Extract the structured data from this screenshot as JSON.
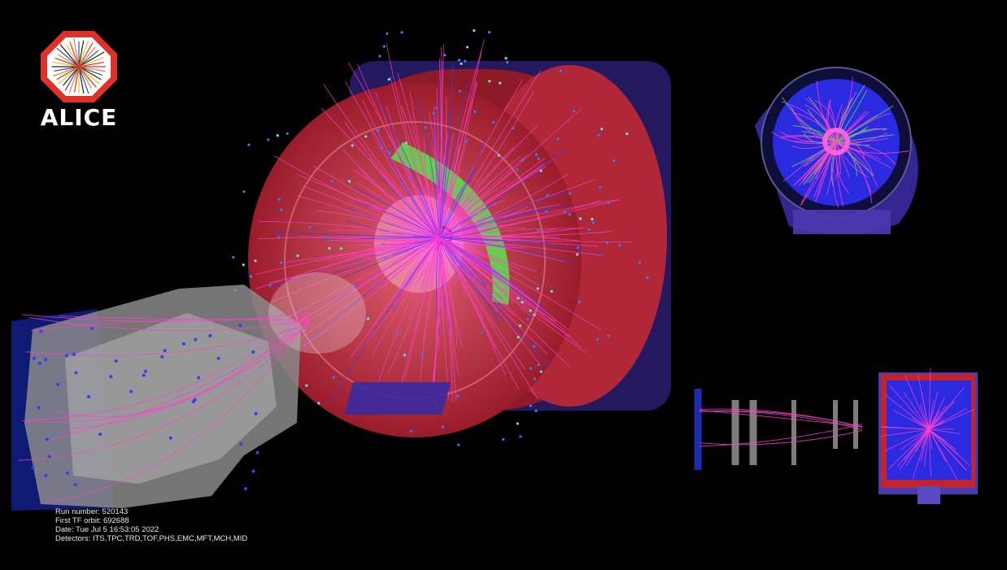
{
  "logo": {
    "name": "ALICE",
    "text": "ALICE"
  },
  "event_info": {
    "run_number": "Run number: 520143",
    "first_tf_orbit": "First TF orbit: 692688",
    "date": "Date: Tue Jul  5 16:53:05 2022",
    "detectors": "Detectors: ITS,TPC,TRD,TOF,PHS,EMC,MFT,MCH,MID"
  },
  "colors": {
    "background": "#000000",
    "tpc_red": "#c0202a",
    "emc_green": "#58e84a",
    "track_pink": "#ff40d0",
    "track_blue": "#3a3aff",
    "muon_gray": "#9a9a9a"
  }
}
